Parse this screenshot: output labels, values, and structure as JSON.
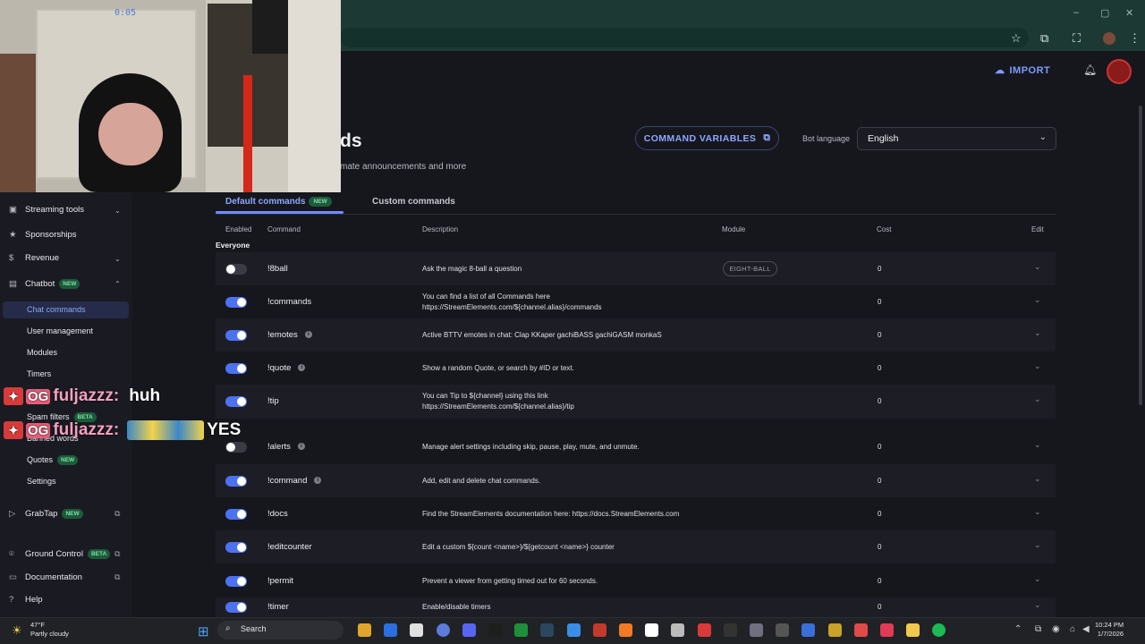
{
  "header": {
    "import_label": "IMPORT"
  },
  "page": {
    "title": "ds",
    "subtitle": "mate announcements and more",
    "command_variables_label": "COMMAND VARIABLES",
    "bot_language_label": "Bot language",
    "bot_language_value": "English"
  },
  "tabs": [
    {
      "label": "Default commands",
      "badge": "NEW",
      "active": true
    },
    {
      "label": "Custom commands",
      "active": false
    }
  ],
  "table": {
    "headers": [
      "Enabled",
      "Command",
      "Description",
      "Module",
      "Cost",
      "Edit"
    ],
    "group_label": "Everyone",
    "rows": [
      {
        "enabled": false,
        "command": "!8ball",
        "info": false,
        "description": [
          "Ask the magic 8-ball a question"
        ],
        "module": "EIGHT-BALL",
        "cost": "0"
      },
      {
        "enabled": true,
        "command": "!commands",
        "info": false,
        "description": [
          "You can find a list of all Commands here",
          "https://StreamElements.com/${channel.alias}/commands"
        ],
        "module": "",
        "cost": "0"
      },
      {
        "enabled": true,
        "command": "!emotes",
        "info": true,
        "description": [
          "Active BTTV emotes in chat: Clap KKaper gachiBASS gachiGASM monkaS"
        ],
        "module": "",
        "cost": "0"
      },
      {
        "enabled": true,
        "command": "!quote",
        "info": true,
        "description": [
          "Show a random Quote, or search by #ID or text."
        ],
        "module": "",
        "cost": "0"
      },
      {
        "enabled": true,
        "command": "!tip",
        "info": false,
        "description": [
          "You can Tip to ${channel} using this link",
          "https://StreamElements.com/${channel.alias}/tip"
        ],
        "module": "",
        "cost": "0"
      },
      {
        "enabled": false,
        "command": "!alerts",
        "info": true,
        "description": [
          "Manage alert settings including skip, pause, play, mute, and unmute."
        ],
        "module": "",
        "cost": "0"
      },
      {
        "enabled": true,
        "command": "!command",
        "info": true,
        "description": [
          "Add, edit and delete chat commands."
        ],
        "module": "",
        "cost": "0"
      },
      {
        "enabled": true,
        "command": "!docs",
        "info": false,
        "description": [
          "Find the StreamElements documentation here: https://docs.StreamElements.com"
        ],
        "module": "",
        "cost": "0"
      },
      {
        "enabled": true,
        "command": "!editcounter",
        "info": false,
        "description": [
          "Edit a custom ${count <name>}/${getcount <name>} counter"
        ],
        "module": "",
        "cost": "0"
      },
      {
        "enabled": true,
        "command": "!permit",
        "info": false,
        "description": [
          "Prevent a viewer from getting timed out for 60 seconds."
        ],
        "module": "",
        "cost": "0"
      },
      {
        "enabled": true,
        "command": "!timer",
        "info": false,
        "description": [
          "Enable/disable timers"
        ],
        "module": "",
        "cost": "0"
      }
    ]
  },
  "sidebar": {
    "streaming_tools": "Streaming tools",
    "sponsorships": "Sponsorships",
    "revenue": "Revenue",
    "chatbot": "Chatbot",
    "chatbot_badge": "NEW",
    "chat_commands": "Chat commands",
    "user_management": "User management",
    "modules": "Modules",
    "timers": "Timers",
    "spam_filters": "Spam filters",
    "spam_filters_badge": "BETA",
    "banned_words": "Banned words",
    "quotes": "Quotes",
    "quotes_badge": "NEW",
    "settings": "Settings",
    "grabtap": "GrabTap",
    "grabtap_badge": "NEW",
    "ground_control": "Ground Control",
    "ground_control_badge": "BETA",
    "documentation": "Documentation",
    "help": "Help"
  },
  "overlay": {
    "clock": "0:05",
    "chat": [
      {
        "badge": "OG",
        "user": "fuljazzz:",
        "message": "huh"
      },
      {
        "badge": "OG",
        "user": "fuljazzz:",
        "message": "YES"
      }
    ]
  },
  "taskbar": {
    "temperature": "47°F",
    "weather": "Partly cloudy",
    "search_placeholder": "Search",
    "time": "10:24 PM",
    "date": "1/7/2026"
  },
  "colors": {
    "accent": "#6f8cff",
    "toggle_on": "#4d72f0",
    "background": "#16171d"
  }
}
